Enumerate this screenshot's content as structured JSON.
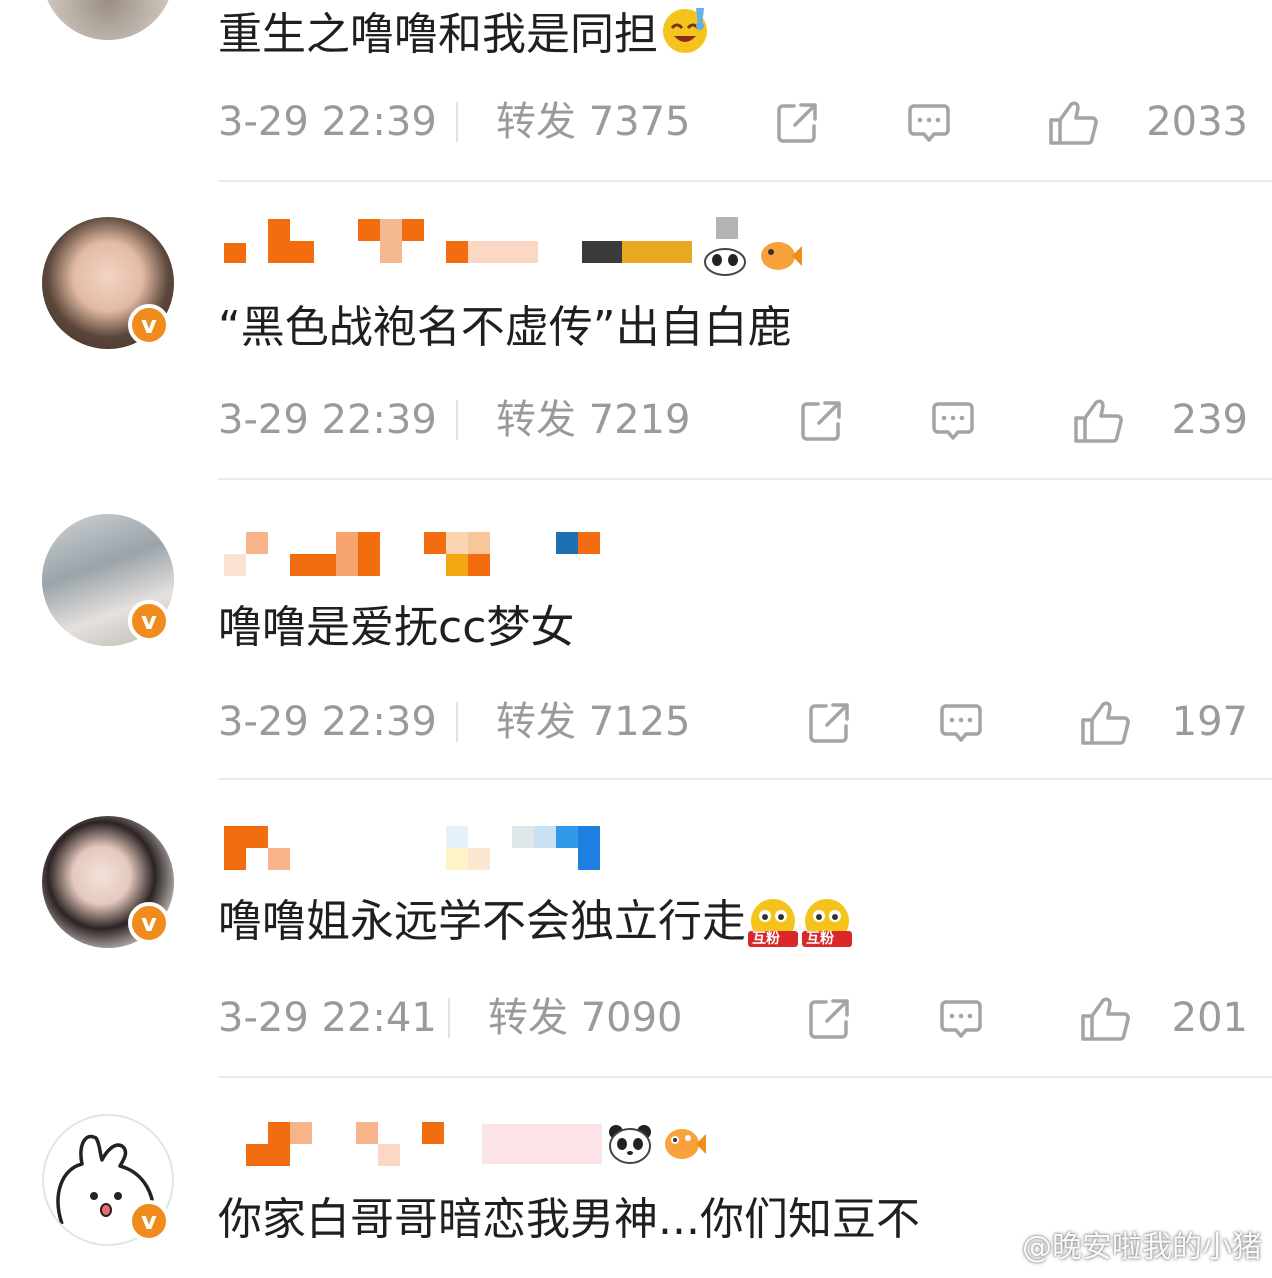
{
  "posts": [
    {
      "comment": "重生之噜噜和我是同担",
      "time": "3-29 22:39",
      "repost_label": "转发 7375",
      "likes": "2033",
      "has_vip": false
    },
    {
      "comment": "“黑色战袍名不虚传”出自白鹿",
      "time": "3-29 22:39",
      "repost_label": "转发 7219",
      "likes": "239",
      "has_vip": true
    },
    {
      "comment": "噜噜是爱抚cc梦女",
      "time": "3-29 22:39",
      "repost_label": "转发 7125",
      "likes": "197",
      "has_vip": true
    },
    {
      "comment": "噜噜姐永远学不会独立行走",
      "time": "3-29 22:41",
      "repost_label": "转发 7090",
      "likes": "201",
      "has_vip": true
    },
    {
      "comment": "你家白哥哥暗恋我男神...你们知豆不",
      "has_vip": true
    }
  ],
  "badges": {
    "vip": "v",
    "fan_badge": "互粉"
  },
  "icons": {
    "share": "share-icon",
    "comment": "comment-icon",
    "like": "thumbs-up-icon"
  },
  "colors": {
    "accent": "#f08b1e",
    "meta_text": "#9a9a9a",
    "divider": "#ececec"
  },
  "watermark": "@晚安啦我的小猪"
}
